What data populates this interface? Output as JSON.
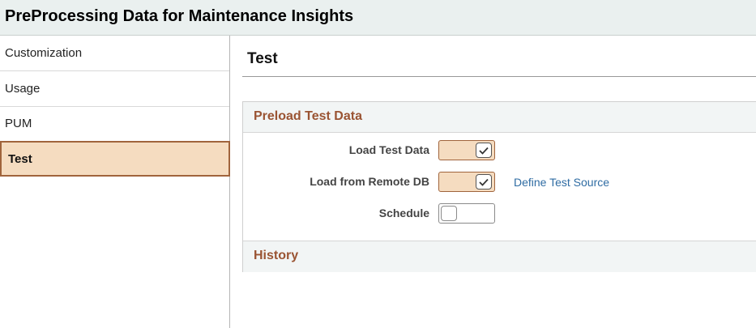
{
  "header": {
    "title": "PreProcessing Data for Maintenance Insights"
  },
  "sidebar": {
    "items": [
      {
        "label": "Customization"
      },
      {
        "label": "Usage"
      },
      {
        "label": "PUM"
      },
      {
        "label": "Test"
      }
    ],
    "active": "Test"
  },
  "main": {
    "title": "Test",
    "preload_section": {
      "header": "Preload Test Data",
      "fields": [
        {
          "label": "Load Test Data",
          "checked": true
        },
        {
          "label": "Load from Remote DB",
          "checked": true,
          "link": "Define Test Source"
        },
        {
          "label": "Schedule",
          "checked": false
        }
      ]
    },
    "history_section": {
      "header": "History"
    }
  },
  "colors": {
    "accent_border": "#a0643c",
    "active_bg": "#f5dcc0",
    "section_header_text": "#9a5433",
    "link": "#2f6ca3"
  }
}
